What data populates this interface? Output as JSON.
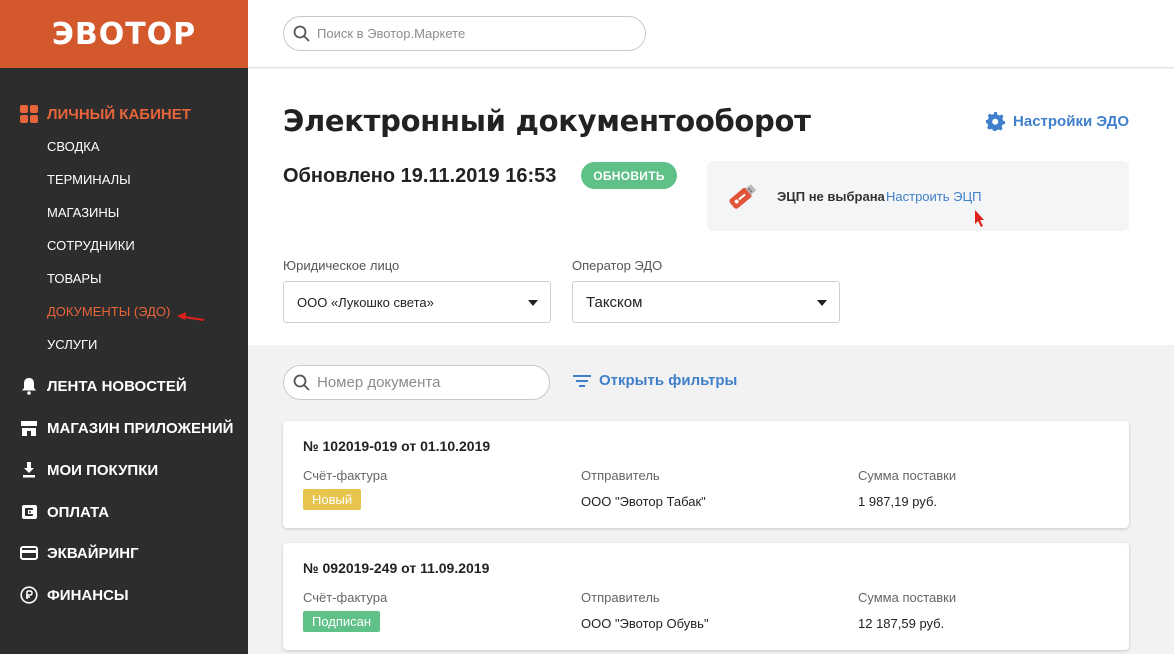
{
  "brand": {
    "logo": "ЭВОТОР",
    "color": "#d3582c"
  },
  "search": {
    "placeholder": "Поиск в Эвотор.Маркете"
  },
  "sidebar": {
    "personal_cabinet": {
      "label": "ЛИЧНЫЙ КАБИНЕТ",
      "icon": "grid-icon",
      "items": [
        {
          "label": "СВОДКА"
        },
        {
          "label": "ТЕРМИНАЛЫ"
        },
        {
          "label": "МАГАЗИНЫ"
        },
        {
          "label": "СОТРУДНИКИ"
        },
        {
          "label": "ТОВАРЫ"
        },
        {
          "label": "ДОКУМЕНТЫ (ЭДО)"
        },
        {
          "label": "УСЛУГИ"
        }
      ]
    },
    "sections": [
      {
        "label": "ЛЕНТА НОВОСТЕЙ",
        "icon": "bell-icon"
      },
      {
        "label": "МАГАЗИН ПРИЛОЖЕНИЙ",
        "icon": "store-icon"
      },
      {
        "label": "МОИ ПОКУПКИ",
        "icon": "download-icon"
      },
      {
        "label": "ОПЛАТА",
        "icon": "wallet-icon"
      },
      {
        "label": "ЭКВАЙРИНГ",
        "icon": "credit-card-icon"
      },
      {
        "label": "ФИНАНСЫ",
        "icon": "ruble-icon"
      }
    ]
  },
  "page": {
    "title": "Электронный документооборот",
    "settings_link": "Настройки ЭДО",
    "updated": "Обновлено 19.11.2019 16:53",
    "refresh_button": "ОБНОВИТЬ",
    "ecp": {
      "status": "ЭЦП не выбрана",
      "link": "Настроить ЭЦП"
    },
    "legal_entity": {
      "label": "Юридическое лицо",
      "value": "ООО «Лукошко света»"
    },
    "operator": {
      "label": "Оператор ЭДО",
      "value": "Такском"
    },
    "doc_search": {
      "placeholder": "Номер документа"
    },
    "filters_link": "Открыть фильтры"
  },
  "documents": [
    {
      "title": "№ 102019-019 от 01.10.2019",
      "type": "Счёт-фактура",
      "status": "Новый",
      "status_color": "#e7c44c",
      "sender_label": "Отправитель",
      "sender": "ООО \"Эвотор Табак\"",
      "sum_label": "Сумма поставки",
      "sum": "1 987,19 руб."
    },
    {
      "title": "№ 092019-249 от 11.09.2019",
      "type": "Счёт-фактура",
      "status": "Подписан",
      "status_color": "#5fc187",
      "sender_label": "Отправитель",
      "sender": "ООО \"Эвотор Обувь\"",
      "sum_label": "Сумма поставки",
      "sum": "12 187,59 руб."
    }
  ],
  "colors": {
    "accent": "#e8643a",
    "link": "#3f7fcb",
    "success": "#5fc187",
    "warning": "#e7c44c",
    "sidebar": "#2d2d2d"
  }
}
